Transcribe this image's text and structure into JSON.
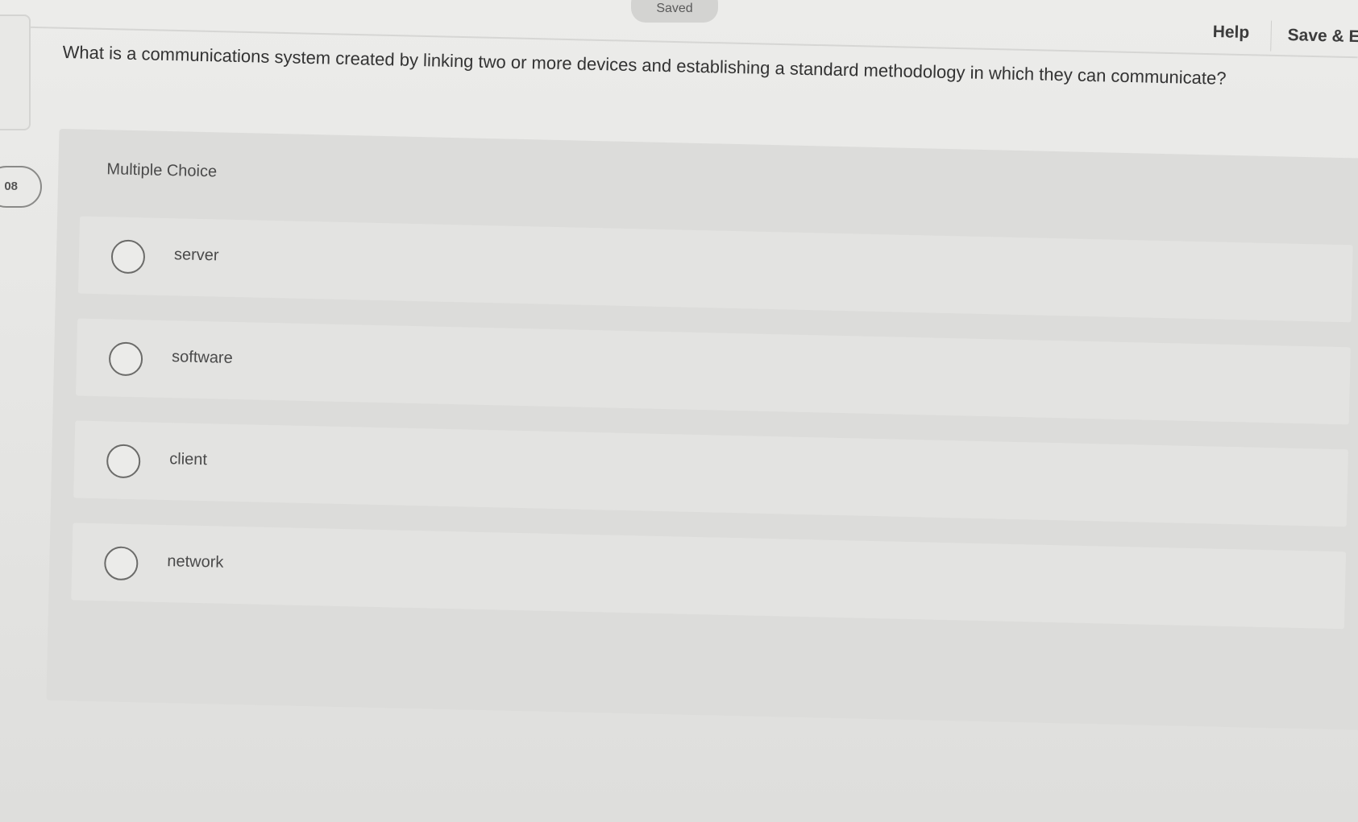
{
  "status": {
    "saved_label": "Saved"
  },
  "timer": {
    "label": "08"
  },
  "header": {
    "help_label": "Help",
    "save_exit_label": "Save & E"
  },
  "question": {
    "text": "What is a communications system created by linking two or more devices and establishing a standard methodology in which they can communicate?",
    "type_label": "Multiple Choice",
    "choices": [
      {
        "label": "server"
      },
      {
        "label": "software"
      },
      {
        "label": "client"
      },
      {
        "label": "network"
      }
    ]
  }
}
